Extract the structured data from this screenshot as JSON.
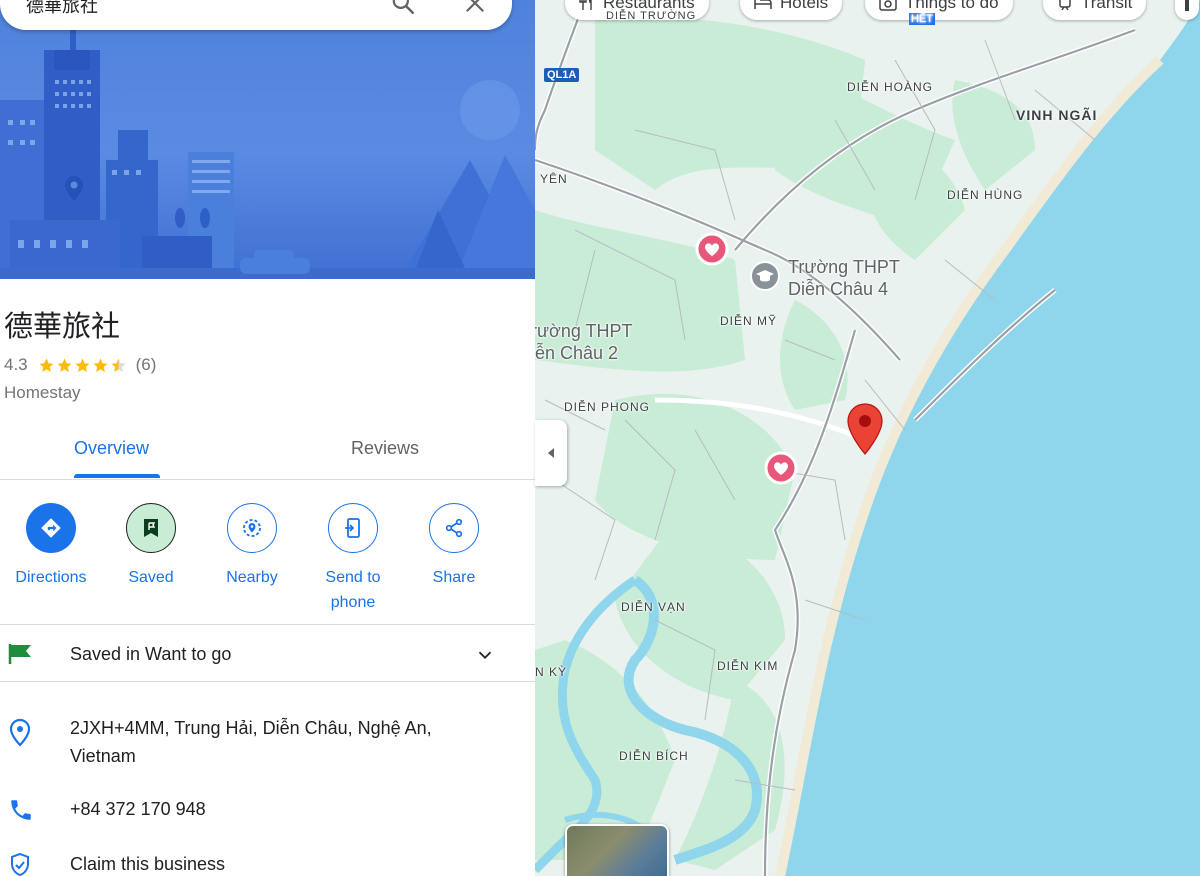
{
  "search": {
    "query": "德華旅社"
  },
  "place": {
    "name": "德華旅社",
    "rating": "4.3",
    "rating_value": 4.3,
    "review_count": "(6)",
    "category": "Homestay"
  },
  "tabs": [
    {
      "label": "Overview",
      "active": true
    },
    {
      "label": "Reviews",
      "active": false
    }
  ],
  "actions": [
    {
      "label": "Directions",
      "icon": "directions-icon"
    },
    {
      "label": "Saved",
      "icon": "bookmark-icon"
    },
    {
      "label": "Nearby",
      "icon": "nearby-icon"
    },
    {
      "label": "Send to phone",
      "icon": "send-to-phone-icon"
    },
    {
      "label": "Share",
      "icon": "share-icon"
    }
  ],
  "saved_list": {
    "label": "Saved in Want to go"
  },
  "details": {
    "address": "2JXH+4MM, Trung Hải, Diễn Châu, Nghệ An, Vietnam",
    "phone": "+84 372 170 948",
    "claim": "Claim this business"
  },
  "map": {
    "chips": [
      "Restaurants",
      "Hotels",
      "Things to do",
      "Transit"
    ],
    "road_shield": "QL1A",
    "labels": {
      "dien_truong": "DIỄN TRƯỜNG",
      "dien_hoang": "DIỄN HOÀNG",
      "vinh_ngai": "VINH NGÃI",
      "yen": "YÊN",
      "dien_hung": "DIỄN HÙNG",
      "dien_my": "DIỄN MỸ",
      "dien_phong": "DIỄN PHONG",
      "dien_van": "DIỄN VẠN",
      "dien_kim": "DIỄN KIM",
      "ky": "N KỲ",
      "dien_bich": "DIỄN BÍCH",
      "het": "HẾT"
    },
    "poi_1": {
      "line1": "Trường THPT",
      "line2": "Diễn Châu 4"
    },
    "poi_2": {
      "line1": "rường THPT",
      "line2": "iễn Châu 2"
    }
  },
  "colors": {
    "accent": "#1a73e8",
    "marker": "#ea4335",
    "sea": "#8fd6ec",
    "land": "#e9f2ee",
    "green": "#c9ecd6",
    "star": "#fbbc04"
  }
}
